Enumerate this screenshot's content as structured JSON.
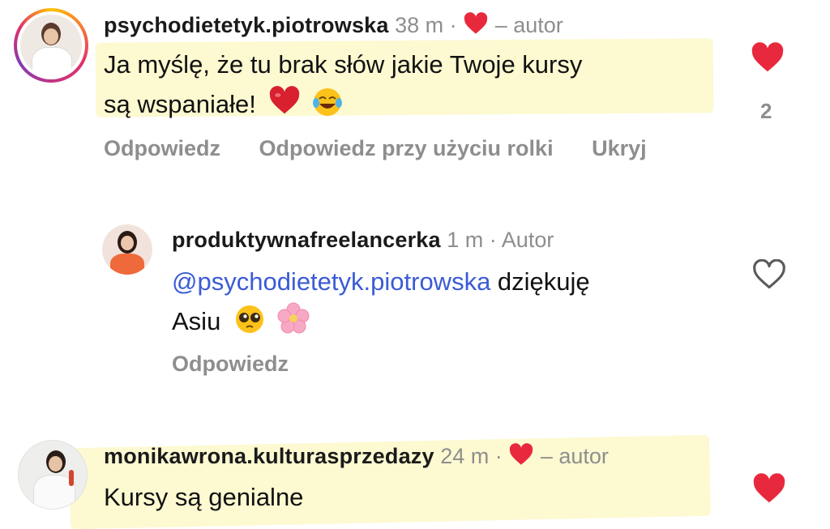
{
  "comments": [
    {
      "username": "psychodietetyk.piotrowska",
      "time": "38 m",
      "separator": "·",
      "author_label": "– autor",
      "text_line1": "Ja myślę, że tu brak słów jakie Twoje kursy",
      "text_line2": "są wspaniałe!",
      "actions": [
        "Odpowiedz",
        "Odpowiedz przy użyciu rolki",
        "Ukryj"
      ],
      "likes": "2",
      "liked": true
    },
    {
      "username": "produktywnafreelancerka",
      "time": "1 m",
      "separator": "·",
      "author_label": "Autor",
      "mention": "@psychodietetyk.piotrowska",
      "text_line1_rest": " dziękuję",
      "text_line2": "Asiu",
      "actions": [
        "Odpowiedz"
      ],
      "liked": false
    },
    {
      "username": "monikawrona.kulturasprzedazy",
      "time": "24 m",
      "separator": "·",
      "author_label": "– autor",
      "text_line1": "Kursy są genialne",
      "liked": true
    }
  ],
  "colors": {
    "like_red": "#e8293d",
    "muted": "#8e8e8e",
    "mention": "#3b5bd6",
    "highlight": "#fdf8c9"
  }
}
